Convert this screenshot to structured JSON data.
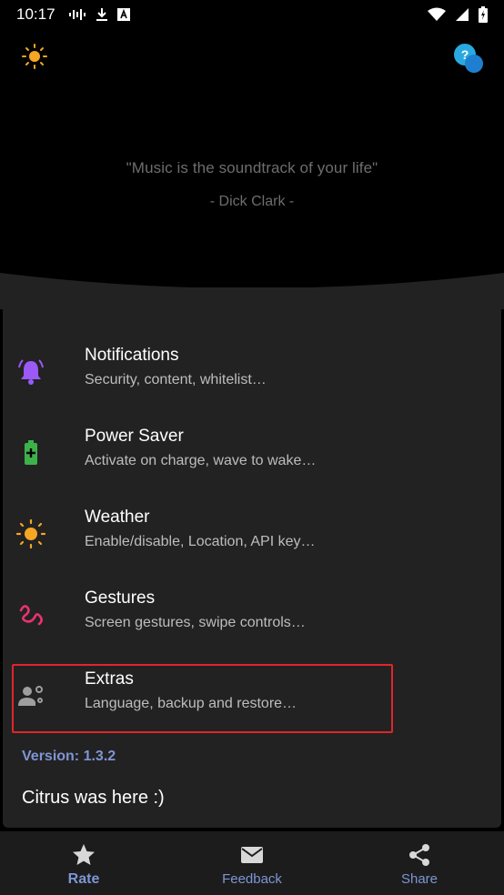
{
  "status_bar": {
    "time": "10:17",
    "icons_left": [
      "voicemail-icon",
      "download-icon",
      "a-box-icon"
    ],
    "icons_right": [
      "wifi-icon",
      "signal-icon",
      "battery-charging-icon"
    ]
  },
  "header": {
    "quote": "\"Music is the soundtrack of your life\"",
    "author": "- Dick Clark -"
  },
  "menu": [
    {
      "title": "Notifications",
      "subtitle": "Security, content, whitelist…",
      "icon": "bell-icon",
      "color": "#9b59f6"
    },
    {
      "title": "Power Saver",
      "subtitle": "Activate on charge, wave to wake…",
      "icon": "battery-plus-icon",
      "color": "#3db24a"
    },
    {
      "title": "Weather",
      "subtitle": "Enable/disable, Location, API key…",
      "icon": "sun-icon",
      "color": "#f5a623"
    },
    {
      "title": "Gestures",
      "subtitle": "Screen gestures, swipe controls…",
      "icon": "gesture-icon",
      "color": "#e8336e"
    },
    {
      "title": "Extras",
      "subtitle": "Language, backup and restore…",
      "icon": "account-gear-icon",
      "color": "#9e9e9e"
    }
  ],
  "version": "Version: 1.3.2",
  "footer_note": "Citrus was here :)",
  "bottom_nav": {
    "rate": "Rate",
    "feedback": "Feedback",
    "share": "Share"
  },
  "colors": {
    "accent": "#7f95d4",
    "panel": "#222222",
    "highlight": "#e0262a"
  }
}
